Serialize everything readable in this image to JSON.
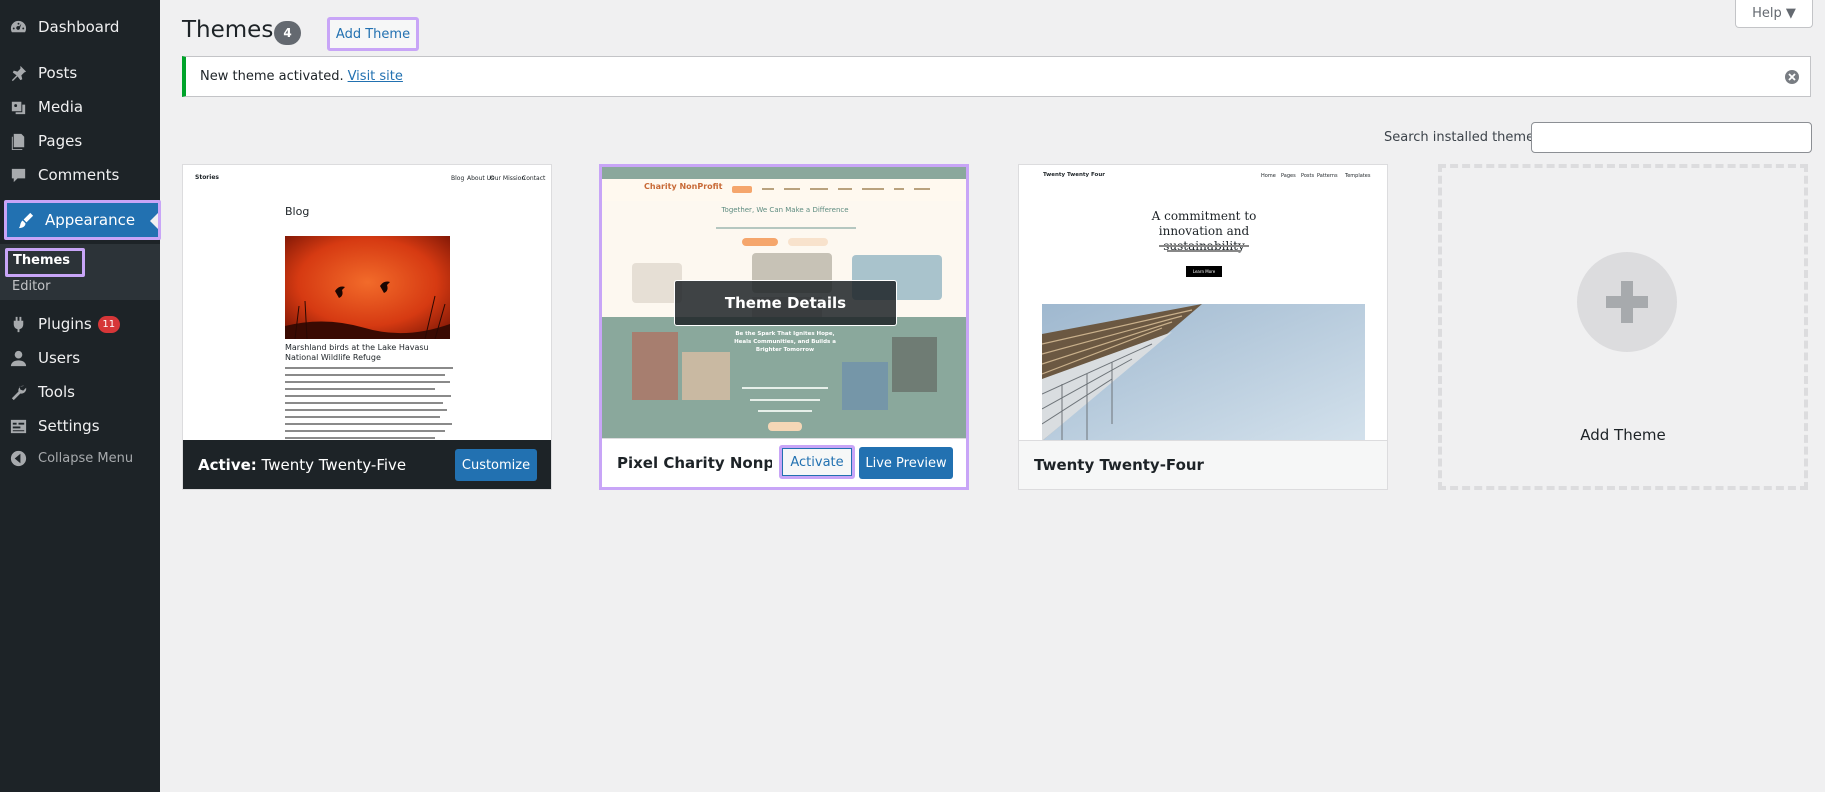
{
  "sidebar": {
    "items": [
      {
        "label": "Dashboard",
        "icon": "dashboard-icon"
      },
      {
        "label": "Posts",
        "icon": "pin-icon"
      },
      {
        "label": "Media",
        "icon": "media-icon"
      },
      {
        "label": "Pages",
        "icon": "pages-icon"
      },
      {
        "label": "Comments",
        "icon": "comment-icon"
      },
      {
        "label": "Appearance",
        "icon": "brush-icon"
      },
      {
        "label": "Plugins",
        "icon": "plugin-icon",
        "badge": "11"
      },
      {
        "label": "Users",
        "icon": "users-icon"
      },
      {
        "label": "Tools",
        "icon": "wrench-icon"
      },
      {
        "label": "Settings",
        "icon": "settings-icon"
      }
    ],
    "submenu": [
      "Themes",
      "Editor"
    ],
    "collapse_label": "Collapse Menu"
  },
  "header": {
    "title": "Themes",
    "count": "4",
    "add_theme_label": "Add Theme",
    "help_label": "Help ▼"
  },
  "notice": {
    "text": "New theme activated.",
    "link": "Visit site"
  },
  "search": {
    "label": "Search installed themes",
    "value": ""
  },
  "themes": [
    {
      "name_prefix": "Active:",
      "name": "Twenty Twenty-Five",
      "button": "Customize",
      "shot": {
        "site": "Stories",
        "nav": [
          "Blog",
          "About Us",
          "Our Mission",
          "Contact"
        ],
        "heading": "Blog",
        "post_title": "Marshland birds at the Lake Havasu National Wildlife Refuge"
      }
    },
    {
      "name": "Pixel Charity Nonprofit",
      "activate": "Activate",
      "preview": "Live Preview",
      "overlay": "Theme Details",
      "shot": {
        "logo": "Charity NonProfit",
        "hero": "Together, We Can Make a Difference",
        "mid": "Be the Spark That Ignites Hope, Heals Communities, and Builds a Brighter Tomorrow"
      }
    },
    {
      "name": "Twenty Twenty-Four",
      "shot": {
        "site": "Twenty Twenty Four",
        "nav": [
          "Home",
          "Pages",
          "Posts",
          "Patterns",
          "Templates"
        ],
        "headline": "A commitment to innovation and sustainability",
        "button": "Learn More"
      }
    }
  ],
  "add_card_label": "Add Theme",
  "colors": {
    "sidebar_bg": "#1d2327",
    "accent": "#2271b1",
    "highlight": "#c8a5f7",
    "notice_success": "#00a32a",
    "badge": "#d63638"
  }
}
